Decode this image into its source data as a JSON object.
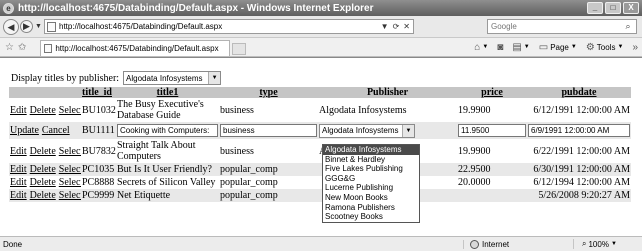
{
  "window": {
    "title": "http://localhost:4675/Databinding/Default.aspx - Windows Internet Explorer",
    "controls": {
      "minimize": "_",
      "maximize": "□",
      "close": "X"
    }
  },
  "addressbar": {
    "url": "http://localhost:4675/Databinding/Default.aspx",
    "search_placeholder": "Google"
  },
  "tab": {
    "label": "http://localhost:4675/Databinding/Default.aspx"
  },
  "commandbar": {
    "page_label": "Page",
    "tools_label": "Tools"
  },
  "page": {
    "publisher_label": "Display titles by publisher:",
    "publisher_selected": "Algodata Infosystems",
    "columns": [
      "title_id",
      "title1",
      "type",
      "Publisher",
      "price",
      "pubdate"
    ],
    "rows": [
      {
        "actions": [
          "Edit",
          "Delete",
          "Select"
        ],
        "title_id": "BU1032",
        "title": "The Busy Executive's Database Guide",
        "type": "business",
        "publisher": "Algodata Infosystems",
        "price": "19.9900",
        "pubdate": "6/12/1991 12:00:00 AM"
      },
      {
        "actions": [
          "Update",
          "Cancel"
        ],
        "title_id": "BU1111",
        "title": "Cooking with Computers:",
        "type": "business",
        "publisher": "Algodata Infosystems",
        "price": "11.9500",
        "pubdate": "6/9/1991 12:00:00 AM"
      },
      {
        "actions": [
          "Edit",
          "Delete",
          "Select"
        ],
        "title_id": "BU7832",
        "title": "Straight Talk About Computers",
        "type": "business",
        "publisher": "Algodata Infosystems",
        "price": "19.9900",
        "pubdate": "6/22/1991 12:00:00 AM"
      },
      {
        "actions": [
          "Edit",
          "Delete",
          "Select"
        ],
        "title_id": "PC1035",
        "title": "But Is It User Friendly?",
        "type": "popular_comp",
        "publisher": "",
        "price": "22.9500",
        "pubdate": "6/30/1991 12:00:00 AM"
      },
      {
        "actions": [
          "Edit",
          "Delete",
          "Select"
        ],
        "title_id": "PC8888",
        "title": "Secrets of Silicon Valley",
        "type": "popular_comp",
        "publisher": "",
        "price": "20.0000",
        "pubdate": "6/12/1994 12:00:00 AM"
      },
      {
        "actions": [
          "Edit",
          "Delete",
          "Select"
        ],
        "title_id": "PC9999",
        "title": "Net Etiquette",
        "type": "popular_comp",
        "publisher": "",
        "price": "",
        "pubdate": "5/26/2008 9:20:27 AM"
      }
    ],
    "publisher_options": [
      "Algodata Infosystems",
      "Binnet & Hardley",
      "Five Lakes Publishing",
      "GGG&G",
      "Lucerne Publishing",
      "New Moon Books",
      "Ramona Publishers",
      "Scootney Books"
    ]
  },
  "statusbar": {
    "status": "Done",
    "zone": "Internet",
    "zoom": "100%"
  }
}
